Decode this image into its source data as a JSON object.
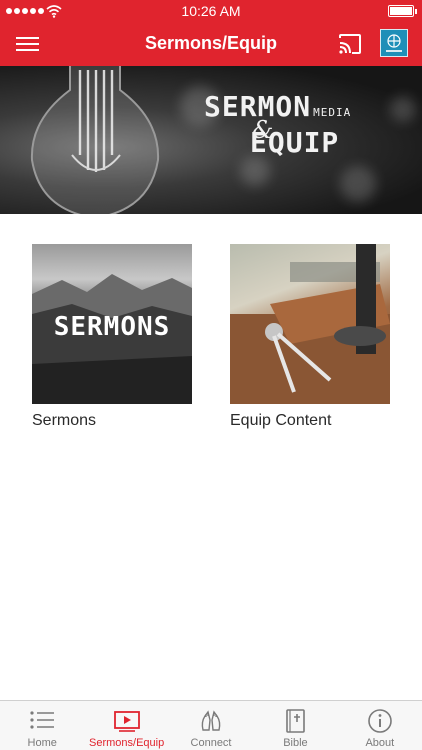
{
  "status_bar": {
    "time": "10:26 AM"
  },
  "nav_bar": {
    "title": "Sermons/Equip"
  },
  "banner": {
    "line1": "SERMON",
    "line1_small": "MEDIA",
    "amp": "&",
    "line2": "EQUIP"
  },
  "cards": [
    {
      "thumb_text": "SERMONS",
      "label": "Sermons"
    },
    {
      "thumb_text": "",
      "label": "Equip Content"
    }
  ],
  "tab_bar": {
    "items": [
      {
        "label": "Home",
        "icon": "list-icon"
      },
      {
        "label": "Sermons/Equip",
        "icon": "play-icon",
        "active": true
      },
      {
        "label": "Connect",
        "icon": "praying-hands-icon"
      },
      {
        "label": "Bible",
        "icon": "bible-icon"
      },
      {
        "label": "About",
        "icon": "info-icon"
      }
    ]
  },
  "colors": {
    "brand_red": "#e0242e",
    "tab_inactive": "#7a7a7a",
    "logo_blue": "#1f8fb8"
  }
}
